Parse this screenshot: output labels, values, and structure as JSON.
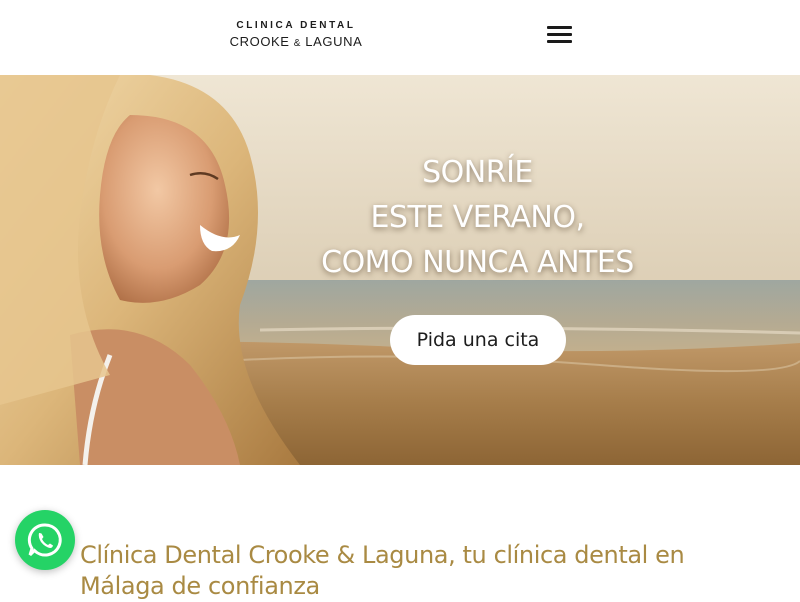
{
  "header": {
    "logo": {
      "line1": "CLINICA  DENTAL",
      "name_part1": "CROOKE",
      "ampersand": "&",
      "name_part2": "LAGUNA"
    },
    "menu_icon": "hamburger-menu-icon"
  },
  "hero": {
    "heading_lines": [
      "SONRÍE",
      "ESTE VERANO,",
      "COMO NUNCA ANTES"
    ],
    "cta_label": "Pida una cita"
  },
  "intro": {
    "title": "Clínica Dental Crooke & Laguna, tu clínica dental en Málaga de confianza"
  },
  "floating": {
    "whatsapp_icon": "whatsapp-icon"
  },
  "colors": {
    "accent_gold": "#a98a43",
    "whatsapp_green": "#25d366",
    "header_bg": "#ffffff",
    "text_dark": "#1a1a1a"
  }
}
